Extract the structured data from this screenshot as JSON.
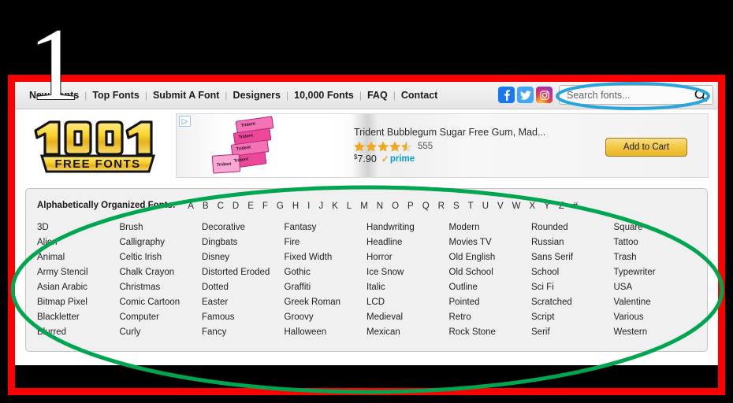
{
  "annotations": {
    "step_number": "1",
    "frame_color": "#ff0000",
    "search_highlight_color": "#29a5dd",
    "content_highlight_color": "#00a550"
  },
  "nav": {
    "separator": "|",
    "links": [
      {
        "label": "New Fonts",
        "name": "nav-new-fonts"
      },
      {
        "label": "Top Fonts",
        "name": "nav-top-fonts"
      },
      {
        "label": "Submit A Font",
        "name": "nav-submit-a-font"
      },
      {
        "label": "Designers",
        "name": "nav-designers"
      },
      {
        "label": "10,000 Fonts",
        "name": "nav-10000-fonts"
      },
      {
        "label": "FAQ",
        "name": "nav-faq"
      },
      {
        "label": "Contact",
        "name": "nav-contact"
      }
    ],
    "social": [
      {
        "name": "facebook-icon",
        "label": "f"
      },
      {
        "name": "twitter-icon",
        "label": "t"
      },
      {
        "name": "instagram-icon",
        "label": "ig"
      }
    ]
  },
  "search": {
    "placeholder": "Search fonts...",
    "value": "",
    "button_icon": "search-icon"
  },
  "logo": {
    "number": "1001",
    "tagline": "FREE FONTS"
  },
  "ad": {
    "adchoices_icon": "adchoices-icon",
    "title": "Trident Bubblegum Sugar Free Gum, Mad...",
    "stars": 4.5,
    "review_count": "555",
    "currency": "$",
    "price": "7.90",
    "prime_label": "prime",
    "cta_label": "Add to Cart"
  },
  "panel": {
    "alpha_label": "Alphabetically Organized Fonts:",
    "letters": [
      "A",
      "B",
      "C",
      "D",
      "E",
      "F",
      "G",
      "H",
      "I",
      "J",
      "K",
      "L",
      "M",
      "N",
      "O",
      "P",
      "Q",
      "R",
      "S",
      "T",
      "U",
      "V",
      "W",
      "X",
      "Y",
      "Z",
      "#"
    ],
    "columns": [
      [
        "3D",
        "Alien",
        "Animal",
        "Army Stencil",
        "Asian Arabic",
        "Bitmap Pixel",
        "Blackletter",
        "Blurred"
      ],
      [
        "Brush",
        "Calligraphy",
        "Celtic Irish",
        "Chalk Crayon",
        "Christmas",
        "Comic Cartoon",
        "Computer",
        "Curly"
      ],
      [
        "Decorative",
        "Dingbats",
        "Disney",
        "Distorted Eroded",
        "Dotted",
        "Easter",
        "Famous",
        "Fancy"
      ],
      [
        "Fantasy",
        "Fire",
        "Fixed Width",
        "Gothic",
        "Graffiti",
        "Greek Roman",
        "Groovy",
        "Halloween"
      ],
      [
        "Handwriting",
        "Headline",
        "Horror",
        "Ice Snow",
        "Italic",
        "LCD",
        "Medieval",
        "Mexican"
      ],
      [
        "Modern",
        "Movies TV",
        "Old English",
        "Old School",
        "Outline",
        "Pointed",
        "Retro",
        "Rock Stone"
      ],
      [
        "Rounded",
        "Russian",
        "Sans Serif",
        "School",
        "Sci Fi",
        "Scratched",
        "Script",
        "Serif"
      ],
      [
        "Square",
        "Tattoo",
        "Trash",
        "Typewriter",
        "USA",
        "Valentine",
        "Various",
        "Western"
      ]
    ]
  }
}
